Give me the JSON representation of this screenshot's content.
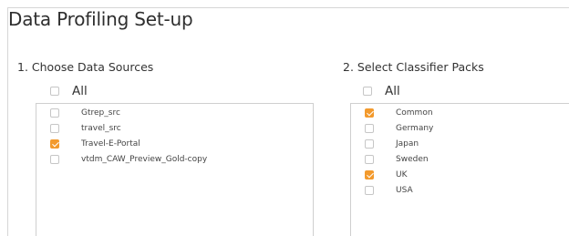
{
  "page": {
    "title": "Data Profiling Set-up"
  },
  "sources": {
    "heading": "1. Choose Data Sources",
    "all_label": "All",
    "all_checked": false,
    "items": [
      {
        "label": "Gtrep_src",
        "checked": false
      },
      {
        "label": "travel_src",
        "checked": false
      },
      {
        "label": "Travel-E-Portal",
        "checked": true
      },
      {
        "label": "vtdm_CAW_Preview_Gold-copy",
        "checked": false
      }
    ]
  },
  "classifiers": {
    "heading": "2. Select Classifier Packs",
    "all_label": "All",
    "all_checked": false,
    "items": [
      {
        "label": "Common",
        "checked": true
      },
      {
        "label": "Germany",
        "checked": false
      },
      {
        "label": "Japan",
        "checked": false
      },
      {
        "label": "Sweden",
        "checked": false
      },
      {
        "label": "UK",
        "checked": true
      },
      {
        "label": "USA",
        "checked": false
      }
    ]
  },
  "colors": {
    "accent": "#f39a2d",
    "border": "#cfcfcf",
    "text": "#333333"
  }
}
